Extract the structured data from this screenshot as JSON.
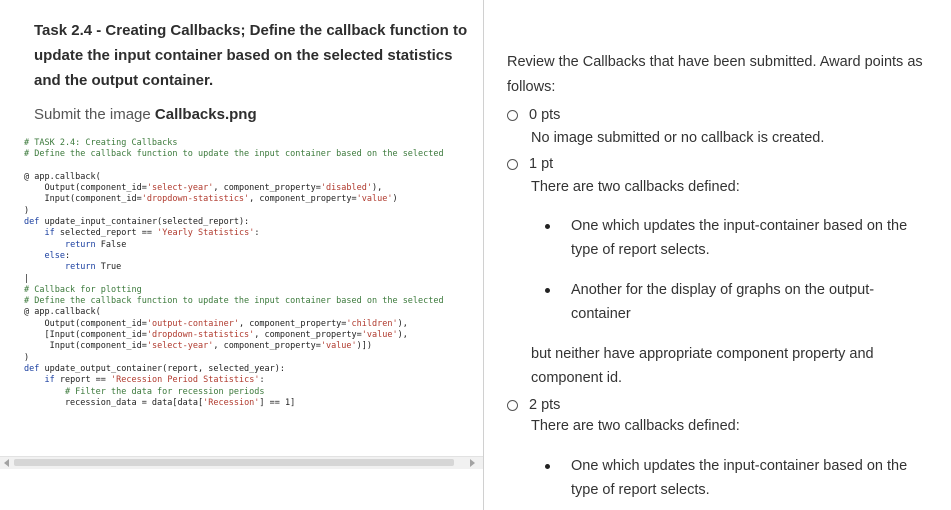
{
  "task": {
    "title": "Task 2.4 - Creating Callbacks; Define the callback function to update the input container based on the selected statistics and the output container.",
    "submit_prefix": "Submit the image ",
    "submit_file": "Callbacks.png"
  },
  "code_lines": [
    "# TASK 2.4: Creating Callbacks",
    "# Define the callback function to update the input container based on the selected",
    "",
    "@ app.callback(",
    "    Output(component_id='select-year', component_property='disabled'),",
    "    Input(component_id='dropdown-statistics', component_property='value')",
    ")",
    "def update_input_container(selected_report):",
    "    if selected_report == 'Yearly Statistics':",
    "        return False",
    "    else:",
    "        return True",
    "|",
    "# Callback for plotting",
    "# Define the callback function to update the input container based on the selected",
    "@ app.callback(",
    "    Output(component_id='output-container', component_property='children'),",
    "    [Input(component_id='dropdown-statistics', component_property='value'),",
    "     Input(component_id='select-year', component_property='value')])",
    ")",
    "def update_output_container(report, selected_year):",
    "    if report == 'Recession Period Statistics':",
    "        # Filter the data for recession periods",
    "        recession_data = data[data['Recession'] == 1]"
  ],
  "rubric": {
    "intro": "Review the Callbacks that have been submitted.  Award points as follows:",
    "options": [
      {
        "label": "0 pts",
        "desc": "No image submitted or no callback is created."
      },
      {
        "label": "1 pt",
        "desc": "There are two callbacks defined:",
        "bullets": [
          "One which updates the input-container based on the type of report selects.",
          "Another for the display of graphs on the output-container"
        ],
        "after": "but neither have appropriate component property and component id."
      },
      {
        "label": "2 pts",
        "desc": "There are two callbacks defined:",
        "bullets": [
          "One which updates the input-container based on the type of report selects."
        ]
      }
    ]
  }
}
